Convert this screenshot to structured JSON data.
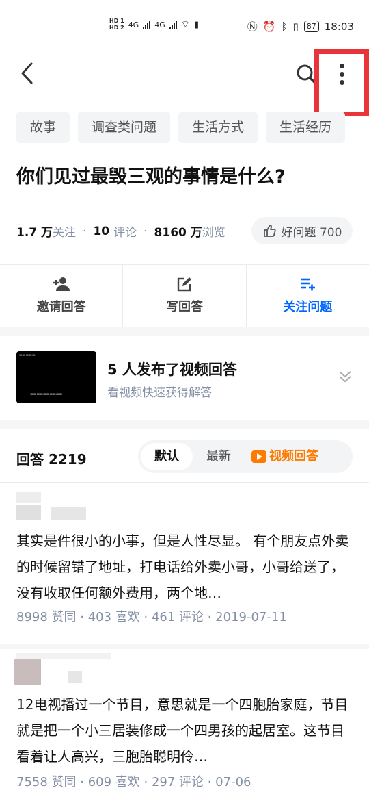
{
  "status_bar": {
    "hd1": "HD 1",
    "hd2": "HD 2",
    "net1": "4G",
    "net2": "4G",
    "battery": "87",
    "time": "18:03"
  },
  "tags": [
    "故事",
    "调查类问题",
    "生活方式",
    "生活经历"
  ],
  "question": {
    "title": "你们见过最毁三观的事情是什么?",
    "followers_value": "1.7 万",
    "followers_label": "关注",
    "comments_value": "10",
    "comments_label": "评论",
    "views_value": "8160 万",
    "views_label": "浏览",
    "good_question_label": "好问题 700"
  },
  "actions": {
    "invite": "邀请回答",
    "write": "写回答",
    "follow": "关注问题"
  },
  "video_answers": {
    "title": "5 人发布了视频回答",
    "subtitle": "看视频快速获得解答"
  },
  "answers": {
    "header": "回答 2219",
    "sort_tabs": [
      "默认",
      "最新",
      "视频回答"
    ],
    "items": [
      {
        "text": "其实是件很小的小事，但是人性尽显。 有个朋友点外卖的时候留错了地址，打电话给外卖小哥，小哥给送了，没有收取任何额外费用，两个地…",
        "meta": "8998 赞同 · 403 喜欢 · 461 评论 · 2019-07-11"
      },
      {
        "text": "12电视播过一个节目，意思就是一个四胞胎家庭，节目就是把一个小三居装修成一个四男孩的起居室。这节目看着让人高兴，三胞胎聪明伶…",
        "meta": "7558 赞同 · 609 喜欢 · 297 评论 · 07-06"
      }
    ]
  },
  "colors": {
    "accent": "#0066ff",
    "highlight_box": "#e8353a",
    "video_orange": "#ff7a00"
  }
}
